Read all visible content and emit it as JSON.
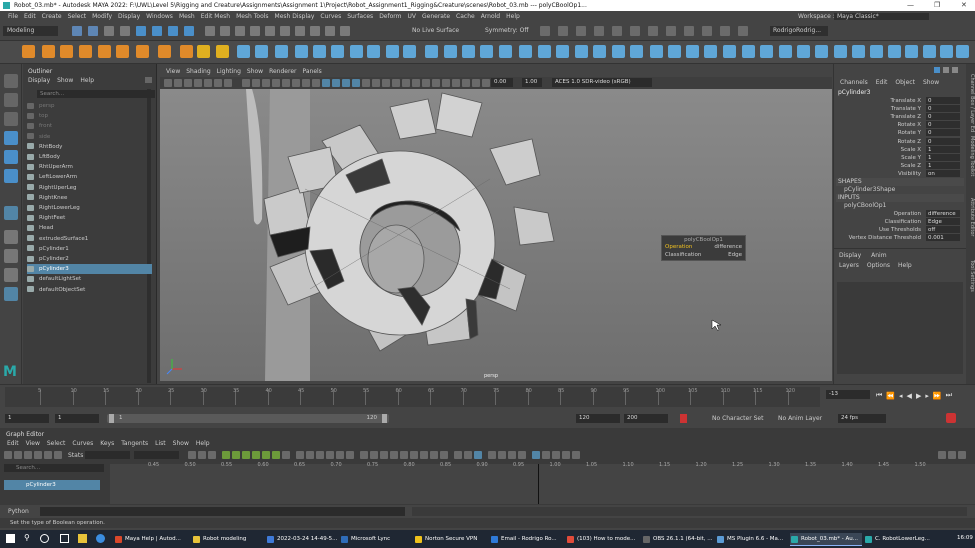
{
  "window": {
    "title": "Robot_03.mb* - Autodesk MAYA 2022: F:\\UWL\\Level 5\\Rigging and Creature\\Assignments\\Assignment 1\\Project\\Robot_Assignment1_Rigging&Creature\\scenes\\Robot_03.mb  ---  polyCBoolOp1...",
    "min": "—",
    "max": "❐",
    "close": "✕"
  },
  "menubar": [
    "File",
    "Edit",
    "Create",
    "Select",
    "Modify",
    "Display",
    "Windows",
    "Mesh",
    "Edit Mesh",
    "Mesh Tools",
    "Mesh Display",
    "Curves",
    "Surfaces",
    "Deform",
    "UV",
    "Generate",
    "Cache",
    "Arnold",
    "Help"
  ],
  "workspace": {
    "label": "Workspace :",
    "value": "Maya Classic*"
  },
  "statusline": {
    "mode": "Modeling",
    "live_surface": "No Live Surface",
    "symmetry": "Symmetry: Off",
    "user": "RodrigoRodrig..."
  },
  "outliner": {
    "title": "Outliner",
    "menus": [
      "Display",
      "Show",
      "Help"
    ],
    "search_placeholder": "Search...",
    "items": [
      {
        "label": "persp",
        "dim": true
      },
      {
        "label": "top",
        "dim": true
      },
      {
        "label": "front",
        "dim": true
      },
      {
        "label": "side",
        "dim": true
      },
      {
        "label": "RhtBody",
        "dim": false
      },
      {
        "label": "LftBody",
        "dim": false
      },
      {
        "label": "RhtUperArm",
        "dim": false
      },
      {
        "label": "LeftLowerArm",
        "dim": false
      },
      {
        "label": "RightUperLeg",
        "dim": false
      },
      {
        "label": "RightKnee",
        "dim": false
      },
      {
        "label": "RightLowerLeg",
        "dim": false
      },
      {
        "label": "RightFeet",
        "dim": false
      },
      {
        "label": "Head",
        "dim": false
      },
      {
        "label": "extrudedSurface1",
        "dim": false
      },
      {
        "label": "pCylinder1",
        "dim": false
      },
      {
        "label": "pCylinder2",
        "dim": false
      },
      {
        "label": "pCylinder3",
        "dim": false,
        "selected": true
      },
      {
        "label": "defaultLightSet",
        "dim": false
      },
      {
        "label": "defaultObjectSet",
        "dim": false
      }
    ]
  },
  "viewport": {
    "menus": [
      "View",
      "Shading",
      "Lighting",
      "Show",
      "Renderer",
      "Panels"
    ],
    "exposure": "0.00",
    "gamma": "1.00",
    "colorspace": "ACES 1.0 SDR-video (sRGB)",
    "camera_label": "persp",
    "hud": {
      "title": "polyCBoolOp1",
      "rows": [
        {
          "k": "Operation",
          "v": "difference"
        },
        {
          "k": "Classification",
          "v": "Edge"
        }
      ]
    }
  },
  "channelbox": {
    "tabs": [
      "Channels",
      "Edit",
      "Object",
      "Show"
    ],
    "object": "pCylinder3",
    "attrs": [
      {
        "n": "Translate X",
        "v": "0"
      },
      {
        "n": "Translate Y",
        "v": "0"
      },
      {
        "n": "Translate Z",
        "v": "0"
      },
      {
        "n": "Rotate X",
        "v": "0"
      },
      {
        "n": "Rotate Y",
        "v": "0"
      },
      {
        "n": "Rotate Z",
        "v": "0"
      },
      {
        "n": "Scale X",
        "v": "1"
      },
      {
        "n": "Scale Y",
        "v": "1"
      },
      {
        "n": "Scale Z",
        "v": "1"
      },
      {
        "n": "Visibility",
        "v": "on"
      }
    ],
    "shapes_label": "SHAPES",
    "shape": "pCylinder3Shape",
    "inputs_label": "INPUTS",
    "input": "polyCBoolOp1",
    "input_attrs": [
      {
        "n": "Operation",
        "v": "difference"
      },
      {
        "n": "Classification",
        "v": "Edge"
      },
      {
        "n": "Use Thresholds",
        "v": "off"
      },
      {
        "n": "Vertex Distance Threshold",
        "v": "0.001"
      }
    ],
    "layer_tabs": [
      "Display",
      "Anim"
    ],
    "layer_menus": [
      "Layers",
      "Options",
      "Help"
    ],
    "side_tabs": [
      "Channel Box / Layer Editor",
      "Modeling Toolkit",
      "Attribute Editor",
      "Tool Settings"
    ]
  },
  "timeslider": {
    "ticks": [
      "5",
      "10",
      "15",
      "20",
      "25",
      "30",
      "35",
      "40",
      "45",
      "50",
      "55",
      "60",
      "65",
      "70",
      "75",
      "80",
      "85",
      "90",
      "95",
      "100",
      "105",
      "110",
      "115",
      "120"
    ],
    "current": "-13"
  },
  "rangeslider": {
    "start": "1",
    "range_start": "1",
    "range_a": "1",
    "range_b": "120",
    "range_end": "120",
    "end": "200",
    "character_set": "No Character Set",
    "anim_layer": "No Anim Layer",
    "fps": "24 fps"
  },
  "graph_editor": {
    "title": "Graph Editor",
    "menus": [
      "Edit",
      "View",
      "Select",
      "Curves",
      "Keys",
      "Tangents",
      "List",
      "Show",
      "Help"
    ],
    "stats": "Stats",
    "search_placeholder": "Search...",
    "item": "pCylinder3",
    "ruler": [
      "0.45",
      "0.50",
      "0.55",
      "0.60",
      "0.65",
      "0.70",
      "0.75",
      "0.80",
      "0.85",
      "0.90",
      "0.95",
      "1.00",
      "1.05",
      "1.10",
      "1.15",
      "1.20",
      "1.25",
      "1.30",
      "1.35",
      "1.40",
      "1.45",
      "1.50"
    ]
  },
  "python": {
    "label": "Python"
  },
  "status_message": "Set the type of Boolean operation.",
  "taskbar": {
    "items": [
      {
        "label": "Maya Help | Autod...",
        "color": "#d9482b"
      },
      {
        "label": "Robot modeling",
        "color": "#e8c33a"
      },
      {
        "label": "2022-03-24 14-49-5...",
        "color": "#3f7ad8"
      },
      {
        "label": "Microsoft Lync",
        "color": "#2f6cb8"
      },
      {
        "label": "Norton Secure VPN",
        "color": "#f0c21c"
      },
      {
        "label": "Email - Rodrigo Ro...",
        "color": "#2f7ad8"
      },
      {
        "label": "(103) How to mode...",
        "color": "#e24b3a"
      },
      {
        "label": "OBS 26.1.1 (64-bit, ...",
        "color": "#666"
      },
      {
        "label": "MS Plugin 6.6 - Ma...",
        "color": "#5b9bd5"
      },
      {
        "label": "Robot_03.mb* - Au...",
        "color": "#2aa9a9",
        "active": true
      },
      {
        "label": "C. RobotLowerLeg...",
        "color": "#2aa9a9"
      }
    ],
    "clock": "16:09"
  }
}
